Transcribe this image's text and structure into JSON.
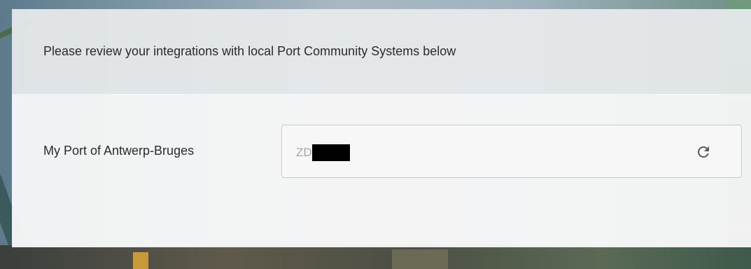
{
  "header": {
    "text": "Please review your integrations with local Port Community Systems below"
  },
  "integrations": [
    {
      "label": "My Port of Antwerp-Bruges",
      "value_visible": "ZD",
      "value_redacted": true,
      "action_icon": "refresh-icon"
    }
  ],
  "colors": {
    "text": "#2b2b2b",
    "muted_text": "#a6a6a6",
    "field_border": "#c9c9c9",
    "icon": "#5a5a5a"
  }
}
